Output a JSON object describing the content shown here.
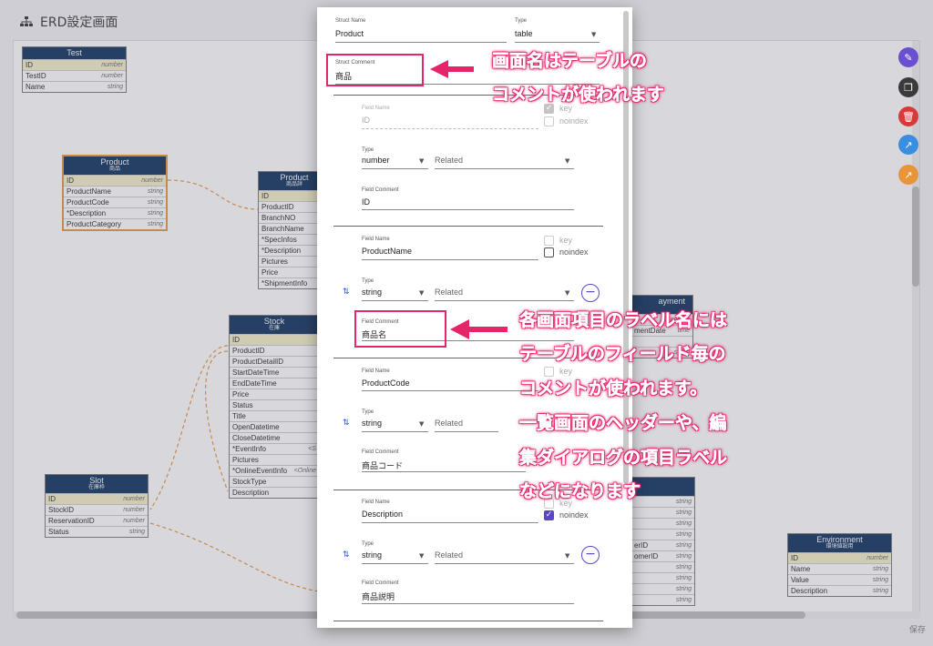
{
  "app": {
    "title": "ERD設定画面",
    "save_label": "保存"
  },
  "entities": {
    "test": {
      "name": "Test",
      "comment": "",
      "fields": [
        {
          "name": "ID",
          "type": "number"
        },
        {
          "name": "TestID",
          "type": "number"
        },
        {
          "name": "Name",
          "type": "string"
        }
      ]
    },
    "product": {
      "name": "Product",
      "comment": "商品",
      "fields": [
        {
          "name": "ID",
          "type": "number"
        },
        {
          "name": "ProductName",
          "type": "string"
        },
        {
          "name": "ProductCode",
          "type": "string"
        },
        {
          "name": "*Description",
          "type": "string"
        },
        {
          "name": "ProductCategory",
          "type": "string"
        }
      ]
    },
    "product2": {
      "name": "Product",
      "comment": "商品詳",
      "fields": [
        {
          "name": "ID",
          "type": ""
        },
        {
          "name": "ProductID",
          "type": ""
        },
        {
          "name": "BranchNO",
          "type": ""
        },
        {
          "name": "BranchName",
          "type": ""
        },
        {
          "name": "*SpecInfos",
          "type": ""
        },
        {
          "name": "*Description",
          "type": ""
        },
        {
          "name": "Pictures",
          "type": ""
        },
        {
          "name": "Price",
          "type": ""
        },
        {
          "name": "*ShipmentInfo",
          "type": "<"
        }
      ]
    },
    "stock": {
      "name": "Stock",
      "comment": "在庫",
      "fields": [
        {
          "name": "ID",
          "type": ""
        },
        {
          "name": "ProductID",
          "type": ""
        },
        {
          "name": "ProductDetailID",
          "type": ""
        },
        {
          "name": "StartDateTime",
          "type": ""
        },
        {
          "name": "EndDateTime",
          "type": ""
        },
        {
          "name": "Price",
          "type": ""
        },
        {
          "name": "Status",
          "type": ""
        },
        {
          "name": "Title",
          "type": ""
        },
        {
          "name": "OpenDatetime",
          "type": ""
        },
        {
          "name": "CloseDatetime",
          "type": ""
        },
        {
          "name": "*EventInfo",
          "type": "<S"
        },
        {
          "name": "Pictures",
          "type": ""
        },
        {
          "name": "*OnlineEventInfo",
          "type": "<Online"
        },
        {
          "name": "StockType",
          "type": ""
        },
        {
          "name": "Description",
          "type": ""
        }
      ]
    },
    "slot": {
      "name": "Slot",
      "comment": "在庫枠",
      "fields": [
        {
          "name": "ID",
          "type": "number"
        },
        {
          "name": "StockID",
          "type": "number"
        },
        {
          "name": "ReservationID",
          "type": "number"
        },
        {
          "name": "Status",
          "type": "string"
        }
      ]
    },
    "payment": {
      "name": "ayment",
      "comment": "",
      "fields": [
        {
          "name": "",
          "type": "numbe"
        },
        {
          "name": "mentDate",
          "type": "time"
        },
        {
          "name": "",
          "type": ""
        },
        {
          "name": "",
          "type": "string"
        }
      ]
    },
    "partial": {
      "name": "",
      "comment": "",
      "fields": [
        {
          "name": "",
          "type": "string"
        },
        {
          "name": "",
          "type": "string"
        },
        {
          "name": "",
          "type": "string"
        },
        {
          "name": "",
          "type": "string"
        },
        {
          "name": "erID",
          "type": "string"
        },
        {
          "name": "omerID",
          "type": "string"
        },
        {
          "name": "",
          "type": "string"
        },
        {
          "name": "",
          "type": "string"
        },
        {
          "name": "",
          "type": "string"
        },
        {
          "name": "",
          "type": "string"
        }
      ]
    },
    "environment": {
      "name": "Environment",
      "comment": "環境値設用",
      "fields": [
        {
          "name": "ID",
          "type": "number"
        },
        {
          "name": "Name",
          "type": "string"
        },
        {
          "name": "Value",
          "type": "string"
        },
        {
          "name": "Description",
          "type": "string"
        }
      ]
    }
  },
  "dialog": {
    "struct_name_label": "Struct Name",
    "struct_name": "Product",
    "type_label": "Type",
    "type_value": "table",
    "struct_comment_label": "Struct Comment",
    "struct_comment": "商品",
    "fields": [
      {
        "name_label": "Field Name",
        "name": "ID",
        "type_label": "Type",
        "type": "number",
        "related": "Related",
        "comment_label": "Field Comment",
        "comment": "ID",
        "key_label": "key",
        "noindex_label": "noindex"
      },
      {
        "name_label": "Field Name",
        "name": "ProductName",
        "type_label": "Type",
        "type": "string",
        "related": "Related",
        "comment_label": "Field Comment",
        "comment": "商品名",
        "key_label": "key",
        "noindex_label": "noindex"
      },
      {
        "name_label": "Field Name",
        "name": "ProductCode",
        "type_label": "Type",
        "type": "string",
        "related": "Related",
        "comment_label": "Field Comment",
        "comment": "商品コード",
        "key_label": "key",
        "noindex_label": ""
      },
      {
        "name_label": "Field Name",
        "name": "Description",
        "type_label": "Type",
        "type": "string",
        "related": "Related",
        "comment_label": "Field Comment",
        "comment": "商品説明",
        "key_label": "key",
        "noindex_label": "noindex"
      }
    ]
  },
  "annotations": {
    "top_line1": "画面名はテーブルの",
    "top_line2": "コメントが使われます",
    "mid_line1": "各画面項目のラベル名には",
    "mid_line2": "テーブルのフィールド毎の",
    "mid_line3": "コメントが使われます。",
    "mid_line4": "一覧画面のヘッダーや、編",
    "mid_line5": "集ダイアログの項目ラベル",
    "mid_line6": "などになります"
  },
  "colors": {
    "entity_header": "#0a2d5a",
    "accent": "#5c46c8",
    "highlight": "#e6246a",
    "selected_border": "#e8953a"
  },
  "icons": {
    "fab1": "edit-icon",
    "fab2": "copy-icon",
    "fab3": "delete-icon",
    "fab4": "trend-icon",
    "fab5": "trend-icon"
  }
}
